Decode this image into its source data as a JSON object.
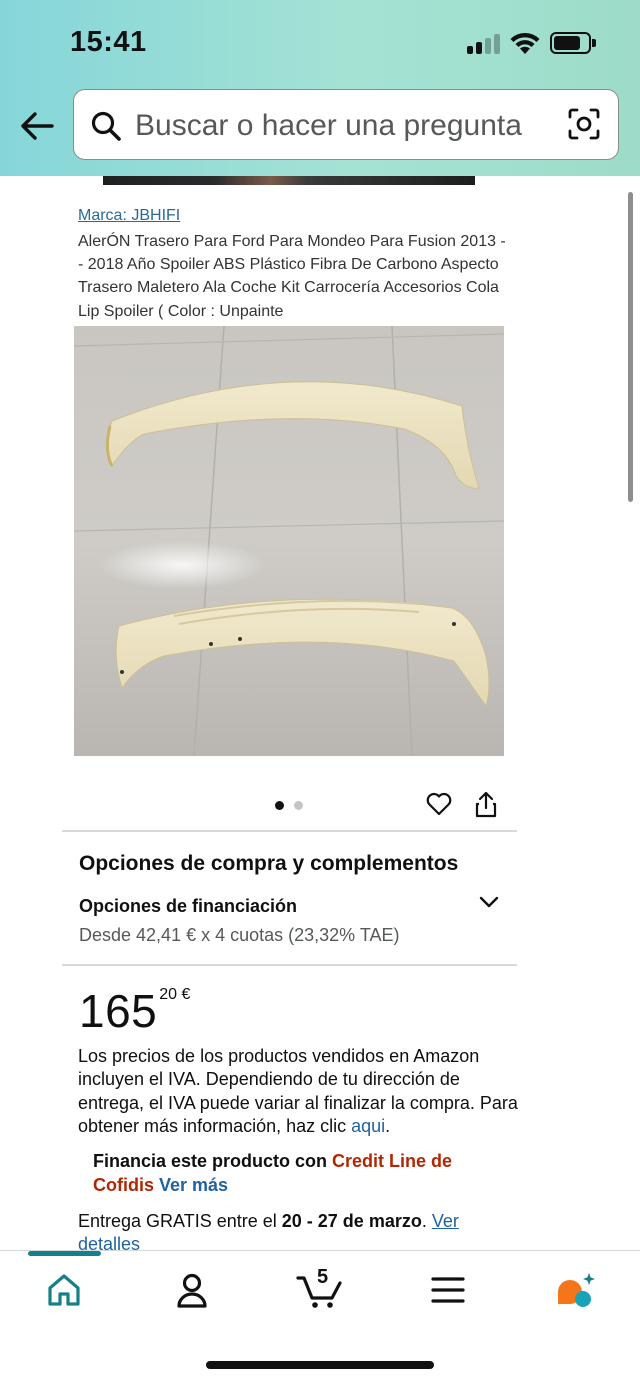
{
  "status_bar": {
    "time": "15:41"
  },
  "search": {
    "placeholder": "Buscar o hacer una pregunta"
  },
  "product": {
    "brand": "Marca: JBHIFI",
    "title": "AlerÓN Trasero Para Ford Para Mondeo Para Fusion 2013 -- 2018 Año Spoiler ABS Plástico Fibra De Carbono Aspecto Trasero Maletero Ala Coche Kit Carrocería Accesorios Cola Lip Spoiler ( Color : Unpainte",
    "image_count": 2,
    "image_index": 1
  },
  "options": {
    "heading": "Opciones de compra y complementos",
    "financing_title": "Opciones de financiación",
    "financing_detail": "Desde 42,41 € x 4 cuotas (23,32% TAE)"
  },
  "price": {
    "whole": "165",
    "fraction": "20 €"
  },
  "vat": {
    "text": "Los precios de los productos vendidos en Amazon incluyen el IVA. Dependiendo de tu dirección de entrega, el IVA puede variar al finalizar la compra. Para obtener más información, haz clic ",
    "link": "aqui",
    "end": "."
  },
  "finance_promo": {
    "lead": "Financia este producto con ",
    "brand": "Credit Line de Cofidis",
    "more": "Ver más"
  },
  "delivery": {
    "lead": "Entrega GRATIS entre el ",
    "dates": "20 - 27 de marzo",
    "sep": ". ",
    "link": "Ver detalles"
  },
  "bottom_nav": {
    "cart_count": "5",
    "active_tab": "home",
    "items": [
      "home",
      "account",
      "cart",
      "menu",
      "rufus"
    ]
  },
  "colors": {
    "header_bg": "#a4e2d4",
    "link": "#2162a1",
    "promo_red": "#b12704",
    "accent_teal": "#16808a",
    "rufus_orange": "#f5761a"
  }
}
